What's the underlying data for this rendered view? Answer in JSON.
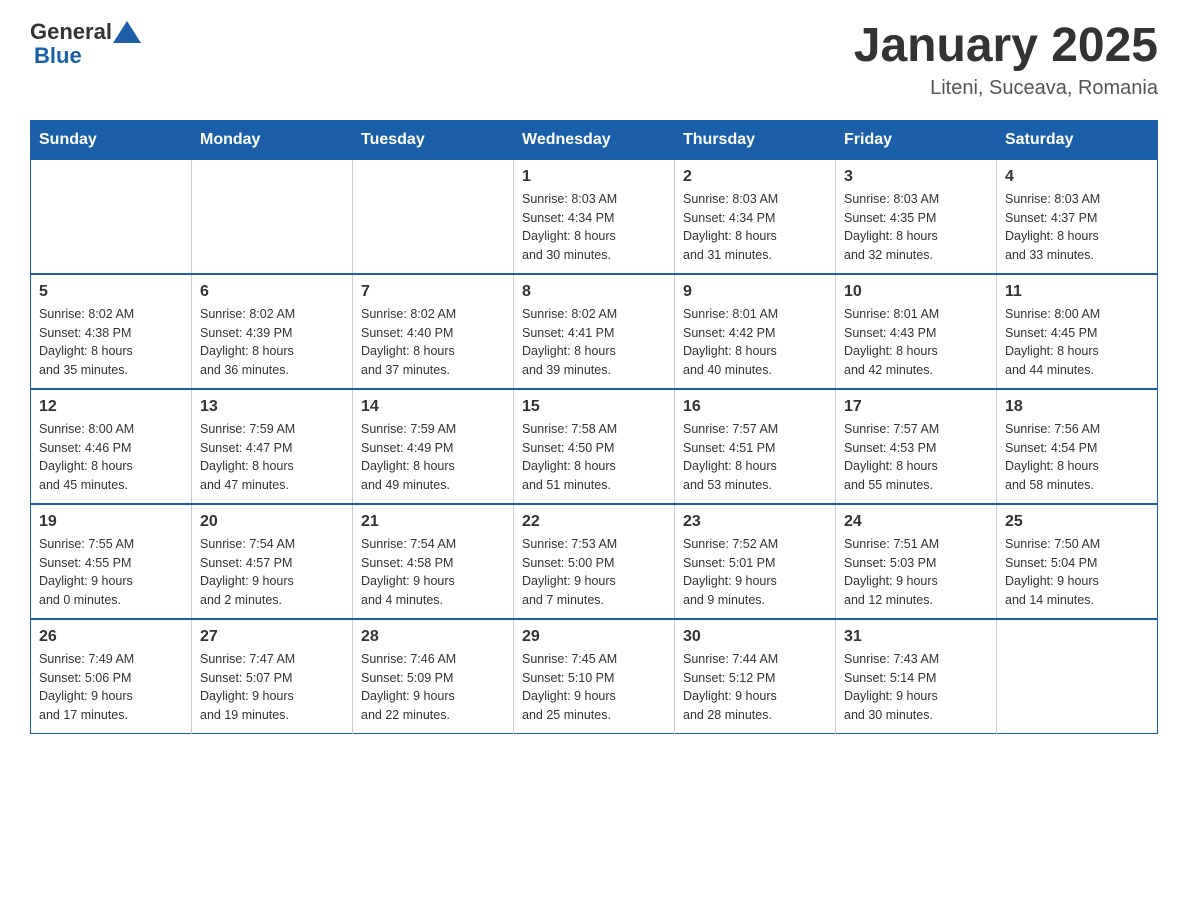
{
  "header": {
    "logo_general": "General",
    "logo_blue": "Blue",
    "title": "January 2025",
    "subtitle": "Liteni, Suceava, Romania"
  },
  "days_of_week": [
    "Sunday",
    "Monday",
    "Tuesday",
    "Wednesday",
    "Thursday",
    "Friday",
    "Saturday"
  ],
  "weeks": [
    [
      {
        "day": "",
        "info": ""
      },
      {
        "day": "",
        "info": ""
      },
      {
        "day": "",
        "info": ""
      },
      {
        "day": "1",
        "info": "Sunrise: 8:03 AM\nSunset: 4:34 PM\nDaylight: 8 hours\nand 30 minutes."
      },
      {
        "day": "2",
        "info": "Sunrise: 8:03 AM\nSunset: 4:34 PM\nDaylight: 8 hours\nand 31 minutes."
      },
      {
        "day": "3",
        "info": "Sunrise: 8:03 AM\nSunset: 4:35 PM\nDaylight: 8 hours\nand 32 minutes."
      },
      {
        "day": "4",
        "info": "Sunrise: 8:03 AM\nSunset: 4:37 PM\nDaylight: 8 hours\nand 33 minutes."
      }
    ],
    [
      {
        "day": "5",
        "info": "Sunrise: 8:02 AM\nSunset: 4:38 PM\nDaylight: 8 hours\nand 35 minutes."
      },
      {
        "day": "6",
        "info": "Sunrise: 8:02 AM\nSunset: 4:39 PM\nDaylight: 8 hours\nand 36 minutes."
      },
      {
        "day": "7",
        "info": "Sunrise: 8:02 AM\nSunset: 4:40 PM\nDaylight: 8 hours\nand 37 minutes."
      },
      {
        "day": "8",
        "info": "Sunrise: 8:02 AM\nSunset: 4:41 PM\nDaylight: 8 hours\nand 39 minutes."
      },
      {
        "day": "9",
        "info": "Sunrise: 8:01 AM\nSunset: 4:42 PM\nDaylight: 8 hours\nand 40 minutes."
      },
      {
        "day": "10",
        "info": "Sunrise: 8:01 AM\nSunset: 4:43 PM\nDaylight: 8 hours\nand 42 minutes."
      },
      {
        "day": "11",
        "info": "Sunrise: 8:00 AM\nSunset: 4:45 PM\nDaylight: 8 hours\nand 44 minutes."
      }
    ],
    [
      {
        "day": "12",
        "info": "Sunrise: 8:00 AM\nSunset: 4:46 PM\nDaylight: 8 hours\nand 45 minutes."
      },
      {
        "day": "13",
        "info": "Sunrise: 7:59 AM\nSunset: 4:47 PM\nDaylight: 8 hours\nand 47 minutes."
      },
      {
        "day": "14",
        "info": "Sunrise: 7:59 AM\nSunset: 4:49 PM\nDaylight: 8 hours\nand 49 minutes."
      },
      {
        "day": "15",
        "info": "Sunrise: 7:58 AM\nSunset: 4:50 PM\nDaylight: 8 hours\nand 51 minutes."
      },
      {
        "day": "16",
        "info": "Sunrise: 7:57 AM\nSunset: 4:51 PM\nDaylight: 8 hours\nand 53 minutes."
      },
      {
        "day": "17",
        "info": "Sunrise: 7:57 AM\nSunset: 4:53 PM\nDaylight: 8 hours\nand 55 minutes."
      },
      {
        "day": "18",
        "info": "Sunrise: 7:56 AM\nSunset: 4:54 PM\nDaylight: 8 hours\nand 58 minutes."
      }
    ],
    [
      {
        "day": "19",
        "info": "Sunrise: 7:55 AM\nSunset: 4:55 PM\nDaylight: 9 hours\nand 0 minutes."
      },
      {
        "day": "20",
        "info": "Sunrise: 7:54 AM\nSunset: 4:57 PM\nDaylight: 9 hours\nand 2 minutes."
      },
      {
        "day": "21",
        "info": "Sunrise: 7:54 AM\nSunset: 4:58 PM\nDaylight: 9 hours\nand 4 minutes."
      },
      {
        "day": "22",
        "info": "Sunrise: 7:53 AM\nSunset: 5:00 PM\nDaylight: 9 hours\nand 7 minutes."
      },
      {
        "day": "23",
        "info": "Sunrise: 7:52 AM\nSunset: 5:01 PM\nDaylight: 9 hours\nand 9 minutes."
      },
      {
        "day": "24",
        "info": "Sunrise: 7:51 AM\nSunset: 5:03 PM\nDaylight: 9 hours\nand 12 minutes."
      },
      {
        "day": "25",
        "info": "Sunrise: 7:50 AM\nSunset: 5:04 PM\nDaylight: 9 hours\nand 14 minutes."
      }
    ],
    [
      {
        "day": "26",
        "info": "Sunrise: 7:49 AM\nSunset: 5:06 PM\nDaylight: 9 hours\nand 17 minutes."
      },
      {
        "day": "27",
        "info": "Sunrise: 7:47 AM\nSunset: 5:07 PM\nDaylight: 9 hours\nand 19 minutes."
      },
      {
        "day": "28",
        "info": "Sunrise: 7:46 AM\nSunset: 5:09 PM\nDaylight: 9 hours\nand 22 minutes."
      },
      {
        "day": "29",
        "info": "Sunrise: 7:45 AM\nSunset: 5:10 PM\nDaylight: 9 hours\nand 25 minutes."
      },
      {
        "day": "30",
        "info": "Sunrise: 7:44 AM\nSunset: 5:12 PM\nDaylight: 9 hours\nand 28 minutes."
      },
      {
        "day": "31",
        "info": "Sunrise: 7:43 AM\nSunset: 5:14 PM\nDaylight: 9 hours\nand 30 minutes."
      },
      {
        "day": "",
        "info": ""
      }
    ]
  ]
}
